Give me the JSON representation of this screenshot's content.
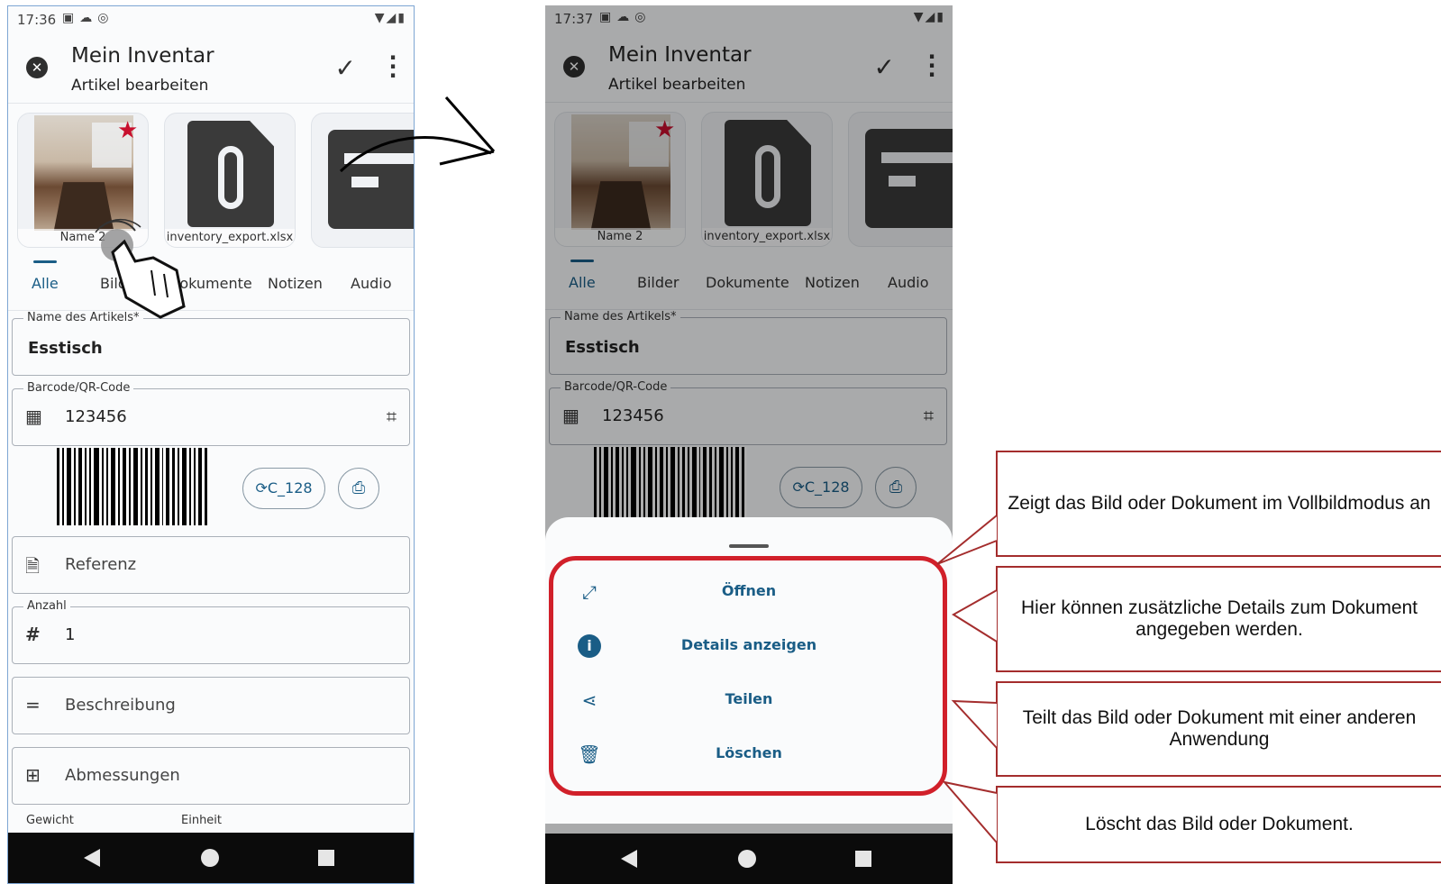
{
  "left_phone": {
    "status": {
      "time": "17:36"
    },
    "appbar": {
      "title": "Mein Inventar",
      "subtitle": "Artikel bearbeiten"
    },
    "attachments": [
      {
        "label": "Name 2",
        "kind": "image",
        "favorite": true
      },
      {
        "label": "inventory_export.xlsx",
        "kind": "file"
      },
      {
        "label": "",
        "kind": "document"
      }
    ],
    "tabs": [
      "Alle",
      "Bilder",
      "Dokumente",
      "Notizen",
      "Audio"
    ],
    "active_tab": "Alle",
    "fields": {
      "name": {
        "label": "Name des Artikels*",
        "value": "Esstisch"
      },
      "barcode": {
        "label": "Barcode/QR-Code",
        "value": "123456"
      },
      "barcode_type_button": "C_128",
      "reference": {
        "placeholder": "Referenz"
      },
      "quantity": {
        "label": "Anzahl",
        "value": "1"
      },
      "description": {
        "placeholder": "Beschreibung"
      },
      "dimensions": {
        "placeholder": "Abmessungen"
      },
      "weight": {
        "label": "Gewicht"
      },
      "unit": {
        "label": "Einheit"
      }
    }
  },
  "right_phone": {
    "status": {
      "time": "17:37"
    },
    "sheet_items": [
      {
        "label": "Öffnen",
        "icon": "expand-icon"
      },
      {
        "label": "Details anzeigen",
        "icon": "info-icon"
      },
      {
        "label": "Teilen",
        "icon": "share-icon"
      },
      {
        "label": "Löschen",
        "icon": "trash-icon"
      }
    ]
  },
  "callouts": [
    "Zeigt das Bild oder Dokument im Vollbildmodus an",
    "Hier können zusätzliche Details zum Dokument angegeben werden.",
    "Teilt das Bild oder Dokument mit einer anderen Anwendung",
    "Löscht das Bild oder Dokument."
  ],
  "colors": {
    "accent": "#1a5d86",
    "highlight": "#d1202a",
    "callout_border": "#a42d2d",
    "favorite": "#c8102e"
  }
}
